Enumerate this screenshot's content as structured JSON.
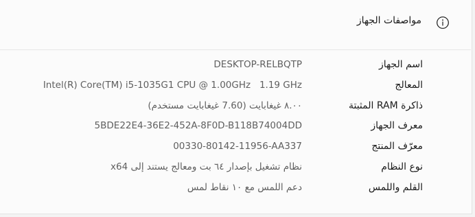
{
  "section": {
    "title": "مواصفات الجهاز",
    "icon": "info-icon"
  },
  "specs": [
    {
      "label": "اسم الجهاز",
      "value": "DESKTOP-RELBQTP"
    },
    {
      "label": "المعالج",
      "value": "Intel(R) Core(TM) i5-1035G1 CPU @ 1.00GHz   1.19 GHz"
    },
    {
      "label": "ذاكرة RAM المثبتة",
      "value": "٨.٠٠ غيغابايت (7.60 غيغابايت مستخدم)"
    },
    {
      "label": "معرف الجهاز",
      "value": "5BDE22E4-36E2-452A-8F0D-B118B74004DD"
    },
    {
      "label": "معرّف المنتج",
      "value": "00330-80142-11956-AA337"
    },
    {
      "label": "نوع النظام",
      "value": "نظام تشغيل بإصدار ٦٤ بت ومعالج يستند إلى x64"
    },
    {
      "label": "القلم واللمس",
      "value": "دعم اللمس مع ١٠ نقاط لمس"
    }
  ],
  "colors": {
    "label_text": "#1b1b1b",
    "value_text": "#5f5f5f",
    "card_bg": "#fbfbfb",
    "divider": "#e6e6e6"
  }
}
